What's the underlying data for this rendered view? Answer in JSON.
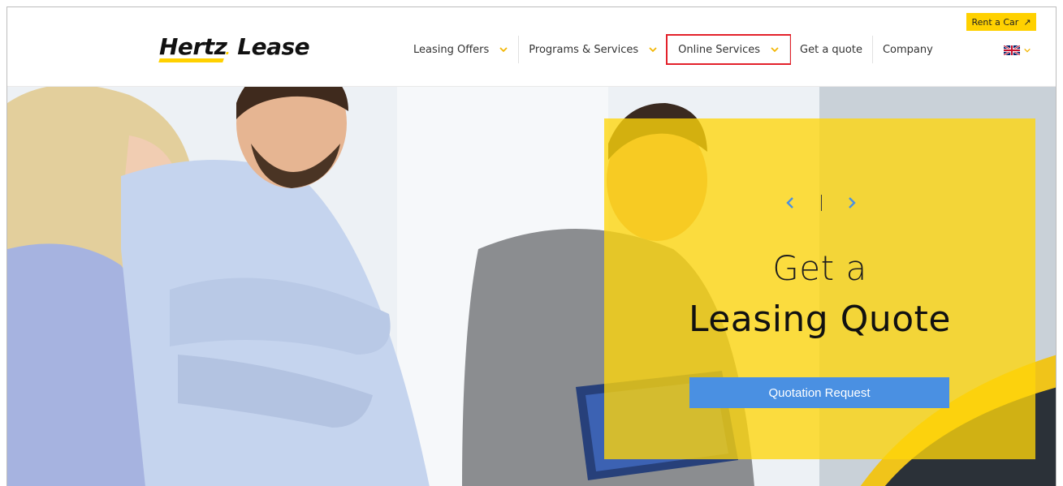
{
  "header": {
    "logo": {
      "brand": "Hertz",
      "suffix": "Lease"
    },
    "nav": [
      {
        "label": "Leasing Offers",
        "has_dropdown": true
      },
      {
        "label": "Programs & Services",
        "has_dropdown": true
      },
      {
        "label": "Online Services",
        "has_dropdown": true,
        "highlighted": true
      },
      {
        "label": "Get a quote",
        "has_dropdown": false
      },
      {
        "label": "Company",
        "has_dropdown": false
      }
    ],
    "rent_a_car": {
      "label": "Rent a Car",
      "icon": "external-arrow-icon"
    },
    "language": {
      "icon": "uk-flag-icon",
      "dropdown_icon": "chevron-down-icon"
    }
  },
  "hero": {
    "promo": {
      "line1": "Get a",
      "line2": "Leasing Quote",
      "button_label": "Quotation Request"
    },
    "pager": {
      "prev_icon": "chevron-left-icon",
      "next_icon": "chevron-right-icon"
    }
  },
  "colors": {
    "brand_yellow": "#ffd100",
    "accent_blue": "#4a90e2",
    "highlight_red": "#e3212b",
    "nav_chevron": "#f2b705"
  }
}
